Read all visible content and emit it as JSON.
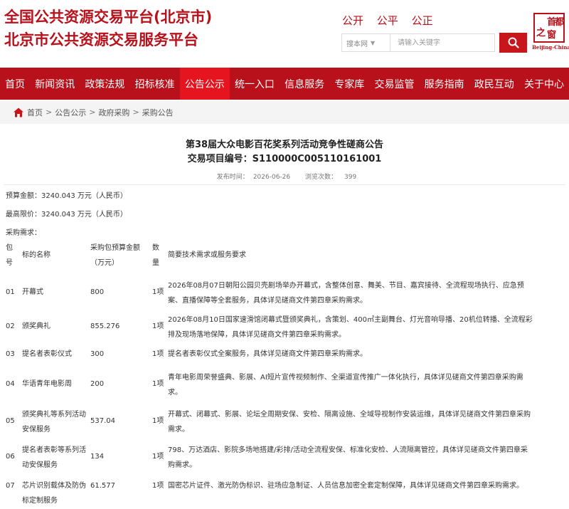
{
  "header": {
    "title_line1": "全国公共资源交易平台(北京市)",
    "title_line2": "北京市公共资源交易服务平台",
    "slogans": [
      "公开",
      "公平",
      "公正"
    ],
    "search": {
      "select_value": "搜本网",
      "placeholder": "请输入关键字"
    },
    "logo": {
      "chars": [
        "首",
        "都",
        "之",
        "窗"
      ],
      "subtitle": "Beijing-China"
    }
  },
  "nav": {
    "items": [
      "首页",
      "新闻资讯",
      "政策法规",
      "招标核准",
      "公告公示",
      "统一入口",
      "信息服务",
      "专家库",
      "交易监管",
      "服务指南",
      "政民互动",
      "关于中心"
    ],
    "active_index": 4
  },
  "breadcrumb": {
    "items": [
      "首页",
      "公告公示",
      "政府采购",
      "采购公告"
    ],
    "separator": ">"
  },
  "article": {
    "title": "第38届大众电影百花奖系列活动竞争性磋商公告",
    "project_code": "交易项目编号：S110000C005110161001",
    "publish_label": "发布时间：",
    "publish_date": "2026-06-26",
    "views_label": "浏览次数：",
    "views": "399",
    "budget": "预算金额：3240.043 万元（人民币）",
    "max_price": "最高限价：3240.043 万元（人民币）",
    "requirements_label": "采购需求："
  },
  "table": {
    "headers": {
      "no_line1": "包",
      "no_line2": "号",
      "name": "标的名称",
      "amount_line1": "采购包预算金额",
      "amount_line2": "（万元）",
      "qty_line1": "数",
      "qty_line2": "量",
      "desc": "简要技术需求或服务要求"
    },
    "rows": [
      {
        "no": "01",
        "name": [
          "开幕式"
        ],
        "amount": "800",
        "qty": "1项",
        "desc": [
          "2026年08月07日朝阳公园贝壳剧场举办开幕式，含整体创意、舞美、节目、嘉宾接待、全流程现场执行、应急预",
          "案、直播保障等全套服务，具体详见磋商文件第四章采购需求。"
        ]
      },
      {
        "no": "02",
        "name": [
          "颁奖典礼"
        ],
        "amount": "855.276",
        "qty": "1项",
        "desc": [
          "2026年08月10日国家速滑馆闭幕式暨颁奖典礼，含策划、400㎡主副舞台、灯光音响导播、20机位转播、全流程彩",
          "排及现场落地保障，具体详见磋商文件第四章采购需求。"
        ]
      },
      {
        "no": "03",
        "name": [
          "提名者表彰仪式"
        ],
        "amount": "300",
        "qty": "1项",
        "desc": [
          "提名者表彰仪式全案服务，具体详见磋商文件第四章采购需求。"
        ]
      },
      {
        "no": "04",
        "name": [
          "华语青年电影周"
        ],
        "amount": "200",
        "qty": "1项",
        "desc": [
          "青年电影周荣誉盛典、影展、AI短片宣传视频制作、全渠道宣传推广一体化执行，具体详见磋商文件第四章采购需",
          "求。"
        ]
      },
      {
        "no": "05",
        "name": [
          "颁奖典礼等系列活动",
          "安保服务"
        ],
        "amount": "537.04",
        "qty": "1项",
        "desc": [
          "开幕式、闭幕式、影展、论坛全周期安保、安检、隔离设施、全域导视制作安装运维，具体详见磋商文件第四章采购",
          "需求。"
        ]
      },
      {
        "no": "06",
        "name": [
          "提名者表彰等系列活",
          "动安保服务"
        ],
        "amount": "134",
        "qty": "1项",
        "desc": [
          "798、万达酒店、影院多场地搭建/彩排/活动全流程安保、标准化安检、人流隔离管控，具体详见磋商文件第四章采",
          "购需求。"
        ]
      },
      {
        "no": "07",
        "name": [
          "芯片识别载体及防伪",
          "标定制服务"
        ],
        "amount": "61.577",
        "qty": "1项",
        "desc": [
          "国密芯片证件、激光防伪标识、驻场应急制证、人员信息加密全套定制保障，具体详见磋商文件第四章采购需求。"
        ]
      }
    ]
  }
}
